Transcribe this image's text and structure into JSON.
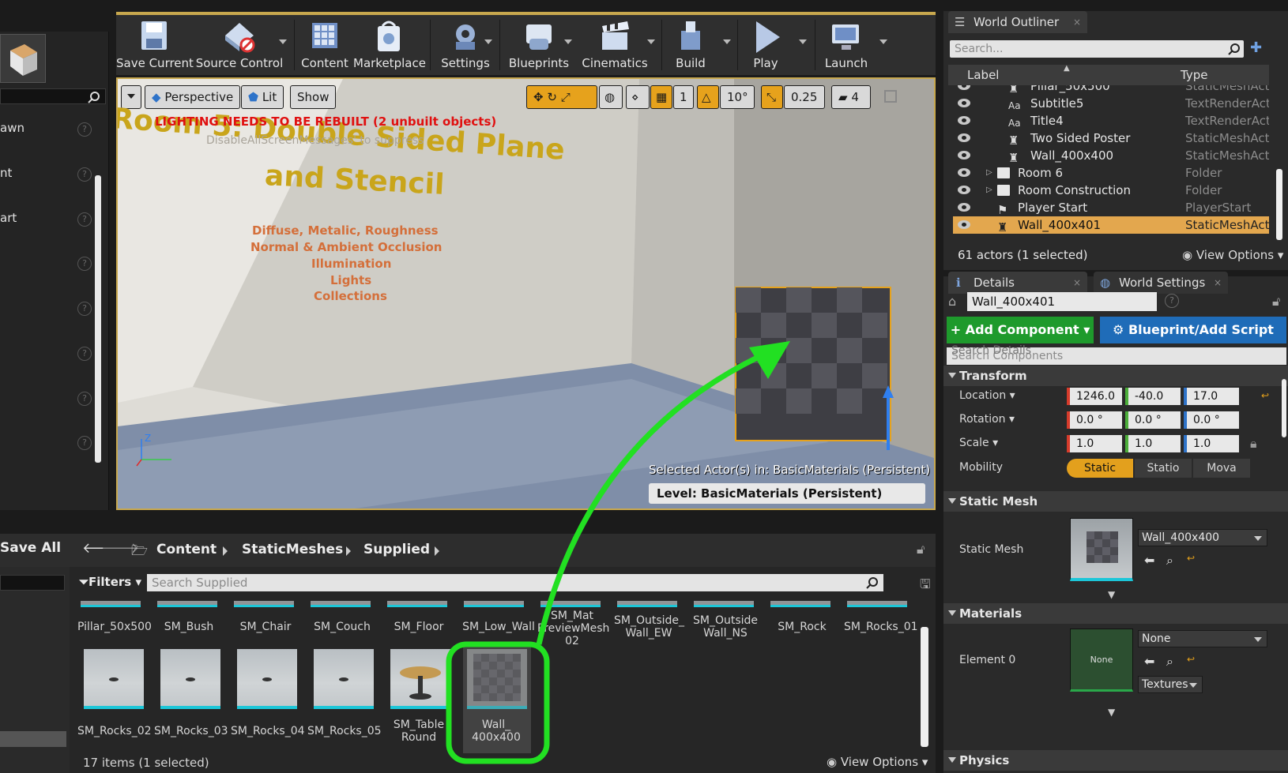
{
  "left_panel": {
    "items": [
      {
        "label": "awn"
      },
      {
        "label": "nt"
      },
      {
        "label": "art"
      },
      {
        "label": ""
      },
      {
        "label": ""
      },
      {
        "label": ""
      },
      {
        "label": ""
      },
      {
        "label": ""
      }
    ]
  },
  "toolbar": {
    "buttons": [
      {
        "label": "Save Current",
        "icon": "save-icon"
      },
      {
        "label": "Source Control",
        "icon": "source-control-icon"
      },
      {
        "label": "Content",
        "icon": "content-icon"
      },
      {
        "label": "Marketplace",
        "icon": "marketplace-icon"
      },
      {
        "label": "Settings",
        "icon": "settings-icon"
      },
      {
        "label": "Blueprints",
        "icon": "blueprints-icon"
      },
      {
        "label": "Cinematics",
        "icon": "cinematics-icon"
      },
      {
        "label": "Build",
        "icon": "build-icon"
      },
      {
        "label": "Play",
        "icon": "play-icon"
      },
      {
        "label": "Launch",
        "icon": "launch-icon"
      }
    ]
  },
  "viewport": {
    "perspective": "Perspective",
    "lit": "Lit",
    "show": "Show",
    "grid_value": "1",
    "rotation_snap": "10°",
    "scale_snap": "0.25",
    "camera_speed": "4",
    "warning": "LIGHTING NEEDS TO BE REBUILT (2 unbuilt objects)",
    "suppress": "DisableAllScreenMessages' to suppress",
    "room_title_1": "Room 5: Double Sided Plane",
    "room_title_2": "and Stencil",
    "room_lines": [
      "Diffuse, Metalic, Roughness",
      "Normal & Ambient Occlusion",
      "Illumination",
      "Lights",
      "Collections"
    ],
    "selected_info": "Selected Actor(s) in:  BasicMaterials (Persistent)",
    "level": "Level:  BasicMaterials (Persistent)",
    "axis_z": "Z"
  },
  "outliner": {
    "tab": "World Outliner",
    "search_placeholder": "Search...",
    "col_label": "Label",
    "col_type": "Type",
    "rows": [
      {
        "label": "Pillar_50x500",
        "type": "StaticMeshActo",
        "icon": "static-mesh-icon"
      },
      {
        "label": "Subtitle5",
        "type": "TextRenderActo",
        "icon": "text-render-icon"
      },
      {
        "label": "Title4",
        "type": "TextRenderActo",
        "icon": "text-render-icon"
      },
      {
        "label": "Two Sided Poster",
        "type": "StaticMeshActo",
        "icon": "static-mesh-icon"
      },
      {
        "label": "Wall_400x400",
        "type": "StaticMeshActo",
        "icon": "static-mesh-icon"
      },
      {
        "label": "Room 6",
        "type": "Folder",
        "icon": "folder-icon"
      },
      {
        "label": "Room Construction",
        "type": "Folder",
        "icon": "folder-icon"
      },
      {
        "label": "Player Start",
        "type": "PlayerStart",
        "icon": "player-start-icon"
      },
      {
        "label": "Wall_400x401",
        "type": "StaticMeshActo",
        "icon": "static-mesh-icon"
      }
    ],
    "footer": "61 actors (1 selected)",
    "view_options": "View Options"
  },
  "details": {
    "tab": "Details",
    "tab2": "World Settings",
    "actor_name": "Wall_400x401",
    "add_component": "+ Add Component",
    "blueprint_script": "Blueprint/Add Script",
    "search_components": "Search Components",
    "search_details": "Search Details",
    "transform": {
      "title": "Transform",
      "location_label": "Location",
      "location": [
        "1246.0",
        "-40.0",
        "17.0"
      ],
      "rotation_label": "Rotation",
      "rotation": [
        "0.0 °",
        "0.0 °",
        "0.0 °"
      ],
      "scale_label": "Scale",
      "scale": [
        "1.0",
        "1.0",
        "1.0"
      ],
      "mobility_label": "Mobility",
      "mobility": [
        "Static",
        "Statio",
        "Mova"
      ]
    },
    "static_mesh": {
      "title": "Static Mesh",
      "label": "Static Mesh",
      "value": "Wall_400x400"
    },
    "materials": {
      "title": "Materials",
      "element_label": "Element 0",
      "value": "None",
      "thumb_text": "None",
      "textures": "Textures"
    },
    "physics": {
      "title": "Physics"
    }
  },
  "content_browser": {
    "save_all": "Save All",
    "breadcrumbs": [
      "Content",
      "StaticMeshes",
      "Supplied"
    ],
    "filters": "Filters",
    "search_placeholder": "Search Supplied",
    "row1": [
      "Pillar_50x500",
      "SM_Bush",
      "SM_Chair",
      "SM_Couch",
      "SM_Floor",
      "SM_Low_Wall",
      "SM_Mat PreviewMesh 02",
      "SM_Outside_ Wall_EW",
      "SM_Outside Wall_NS",
      "SM_Rock",
      "SM_Rocks_01"
    ],
    "row2": [
      "SM_Rocks_02",
      "SM_Rocks_03",
      "SM_Rocks_04",
      "SM_Rocks_05",
      "SM_Table Round",
      "Wall_ 400x400"
    ],
    "footer": "17 items (1 selected)",
    "view_options": "View Options"
  },
  "colors": {
    "selection": "#e3a74e",
    "accent_orange": "#e6a21c",
    "annotation_green": "#22e022",
    "add_component_green": "#1e9a2c",
    "blueprint_blue": "#1f6cb8",
    "thumb_bar": "#1cc6d8"
  }
}
